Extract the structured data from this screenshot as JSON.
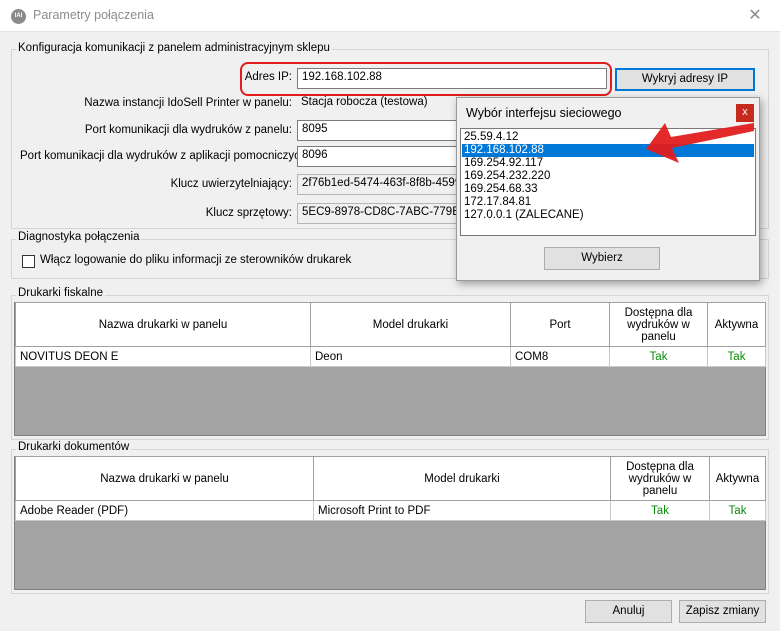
{
  "window": {
    "title": "Parametry połączenia",
    "icon_text": "IAI",
    "close_glyph": "✕"
  },
  "connection": {
    "legend": "Konfiguracja komunikacji z panelem administracyjnym sklepu",
    "ip_label": "Adres IP:",
    "ip_value": "192.168.102.88",
    "detect_ip_button": "Wykryj adresy IP",
    "instance_label": "Nazwa instancji IdoSell Printer w panelu:",
    "instance_value": "Stacja robocza (testowa)",
    "panel_port_label": "Port komunikacji dla wydruków z panelu:",
    "panel_port_value": "8095",
    "helper_port_label": "Port komunikacji dla wydruków z aplikacji pomocniczych:",
    "helper_port_value": "8096",
    "auth_key_label": "Klucz uwierzytelniający:",
    "auth_key_value": "2f76b1ed-5474-463f-8f8b-45997e",
    "hw_key_label": "Klucz sprzętowy:",
    "hw_key_value": "5EC9-8978-CD8C-7ABC-779B-5C"
  },
  "diagnostics": {
    "legend": "Diagnostyka połączenia",
    "logging_label": "Włącz logowanie do pliku informacji ze sterowników drukarek",
    "logging_checked": false
  },
  "fiscal": {
    "legend": "Drukarki fiskalne",
    "columns": [
      "Nazwa drukarki w panelu",
      "Model drukarki",
      "Port",
      "Dostępna dla wydruków w panelu",
      "Aktywna"
    ],
    "rows": [
      {
        "name": "NOVITUS DEON E",
        "model": "Deon",
        "port": "COM8",
        "available": "Tak",
        "active": "Tak"
      }
    ]
  },
  "documents": {
    "legend": "Drukarki dokumentów",
    "columns": [
      "Nazwa drukarki w panelu",
      "Model drukarki",
      "Dostępna dla wydruków w panelu",
      "Aktywna"
    ],
    "rows": [
      {
        "name": "Adobe Reader (PDF)",
        "model": "Microsoft Print to PDF",
        "available": "Tak",
        "active": "Tak"
      }
    ]
  },
  "footer": {
    "cancel_button": "Anuluj",
    "save_button": "Zapisz zmiany"
  },
  "popup": {
    "title": "Wybór interfejsu sieciowego",
    "close_glyph": "x",
    "items": [
      "25.59.4.12",
      "192.168.102.88",
      "169.254.92.117",
      "169.254.232.220",
      "169.254.68.33",
      "172.17.84.81",
      "127.0.0.1 (ZALECANE)"
    ],
    "selected_index": 1,
    "select_button": "Wybierz"
  },
  "colors": {
    "highlight": "#e11d1d",
    "selection": "#0078d7",
    "yes_text": "#0a8a0a",
    "popup_close": "#c42b1c"
  }
}
